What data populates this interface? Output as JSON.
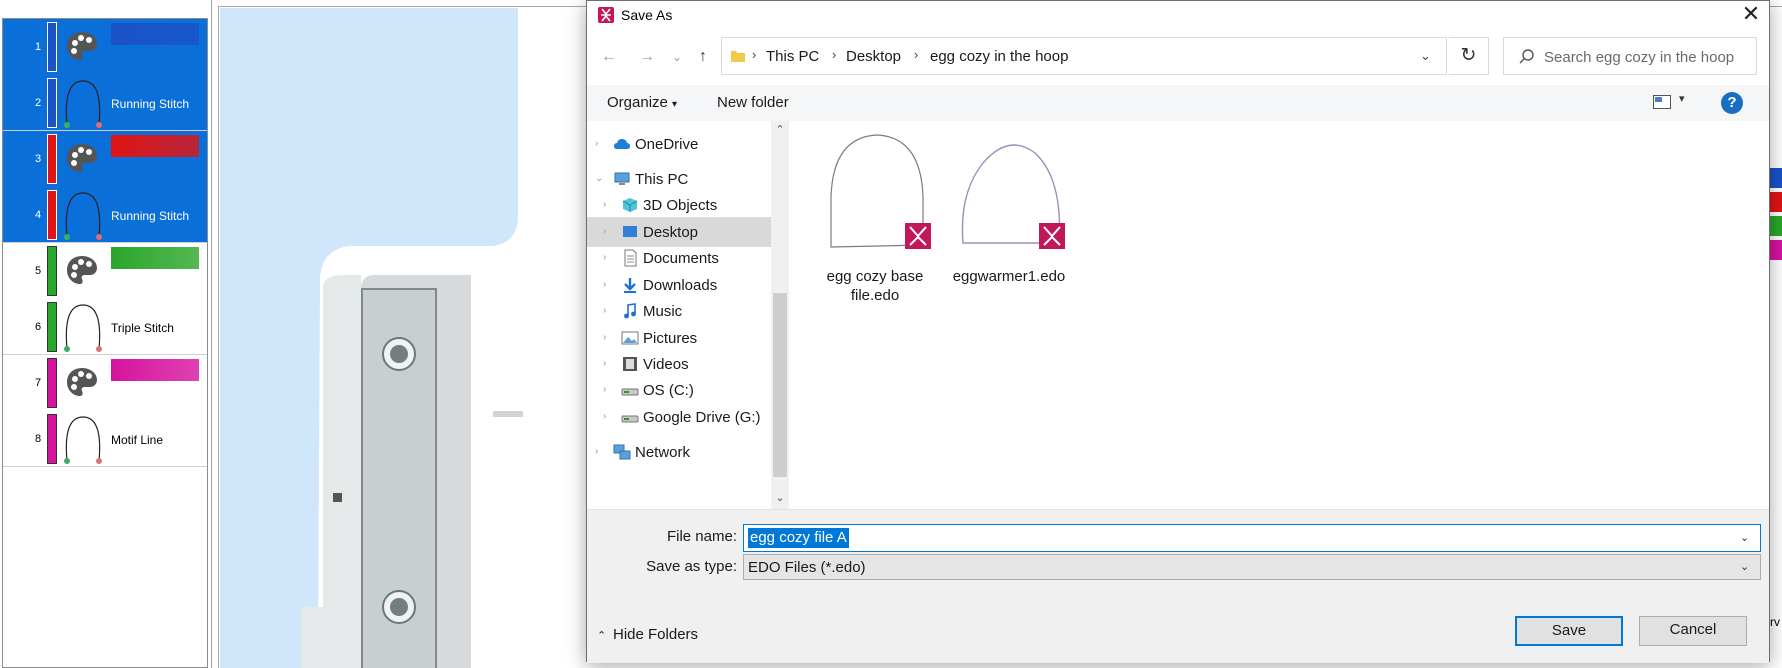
{
  "sequence": {
    "items": [
      {
        "num": "1",
        "color": "#1b52c8",
        "kind": "color"
      },
      {
        "num": "2",
        "color": "#1b52c8",
        "kind": "stitch",
        "label": "Running Stitch"
      },
      {
        "num": "3",
        "color": "#e01414",
        "kind": "color"
      },
      {
        "num": "4",
        "color": "#e01414",
        "kind": "stitch",
        "label": "Running Stitch"
      },
      {
        "num": "5",
        "color": "#2aa62a",
        "kind": "color"
      },
      {
        "num": "6",
        "color": "#2aa62a",
        "kind": "stitch",
        "label": "Triple Stitch"
      },
      {
        "num": "7",
        "color": "#d6139e",
        "kind": "color"
      },
      {
        "num": "8",
        "color": "#d6139e",
        "kind": "stitch",
        "label": "Motif Line"
      }
    ]
  },
  "edge_label": "rv",
  "dialog": {
    "title": "Save As",
    "close_glyph": "✕",
    "nav": {
      "back": "←",
      "forward": "→",
      "recent": "⌄",
      "up": "↑"
    },
    "breadcrumbs": [
      "This PC",
      "Desktop",
      "egg cozy in the hoop"
    ],
    "breadcrumb_sep": "›",
    "search_placeholder": "Search egg cozy in the hoop",
    "toolbar": {
      "organize": "Organize",
      "new_folder": "New folder",
      "help": "?"
    },
    "nav_items": [
      {
        "label": "OneDrive",
        "icon": "cloud-icon",
        "level": 0
      },
      {
        "label": "This PC",
        "icon": "computer-icon",
        "level": 0
      },
      {
        "label": "3D Objects",
        "icon": "cube-icon",
        "level": 1
      },
      {
        "label": "Desktop",
        "icon": "desktop-icon",
        "level": 1,
        "selected": true
      },
      {
        "label": "Documents",
        "icon": "document-icon",
        "level": 1
      },
      {
        "label": "Downloads",
        "icon": "download-icon",
        "level": 1
      },
      {
        "label": "Music",
        "icon": "music-icon",
        "level": 1
      },
      {
        "label": "Pictures",
        "icon": "pictures-icon",
        "level": 1
      },
      {
        "label": "Videos",
        "icon": "videos-icon",
        "level": 1
      },
      {
        "label": "OS (C:)",
        "icon": "drive-icon",
        "level": 1
      },
      {
        "label": "Google Drive (G:)",
        "icon": "drive-icon",
        "level": 1
      },
      {
        "label": "Network",
        "icon": "network-icon",
        "level": 0
      }
    ],
    "files": [
      {
        "name": "egg cozy base file.edo"
      },
      {
        "name": "eggwarmer1.edo"
      }
    ],
    "file_name_label": "File name:",
    "file_name_value": "egg cozy file A",
    "save_type_label": "Save as type:",
    "save_type_value": "EDO Files (*.edo)",
    "hide_folders": "Hide Folders",
    "save_button": "Save",
    "cancel_button": "Cancel"
  }
}
